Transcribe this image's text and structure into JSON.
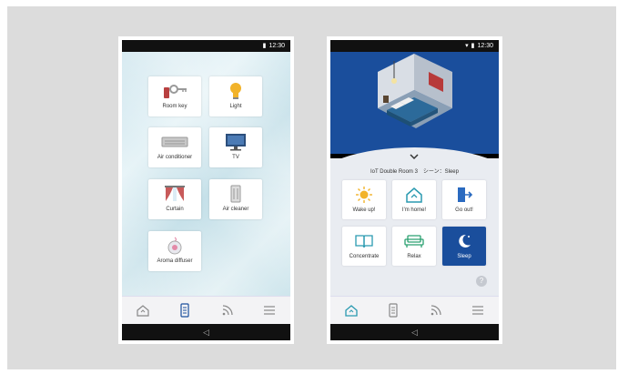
{
  "colors": {
    "accent": "#1a4e9c",
    "background": "#dcdcdc"
  },
  "status_bar": {
    "time": "12:30"
  },
  "nav_bar": {
    "back_glyph": "◁"
  },
  "devices_screen": {
    "tiles": [
      {
        "label": "Room key",
        "icon": "room-key-icon"
      },
      {
        "label": "Light",
        "icon": "light-bulb-icon"
      },
      {
        "label": "Air conditioner",
        "icon": "air-conditioner-icon"
      },
      {
        "label": "TV",
        "icon": "tv-icon"
      },
      {
        "label": "Curtain",
        "icon": "curtain-icon"
      },
      {
        "label": "Air cleaner",
        "icon": "air-cleaner-icon"
      },
      {
        "label": "Aroma diffuser",
        "icon": "aroma-diffuser-icon"
      }
    ],
    "tabs": [
      "home-icon",
      "remote-icon",
      "wifi-icon",
      "menu-icon"
    ],
    "active_tab": "remote-icon"
  },
  "scenes_screen": {
    "room_title": "IoT Double Room 3　シーン：Sleep",
    "tiles": [
      {
        "label": "Wake up!",
        "icon": "sun-icon"
      },
      {
        "label": "I'm home!",
        "icon": "house-icon"
      },
      {
        "label": "Go out!",
        "icon": "door-exit-icon"
      },
      {
        "label": "Concentrate",
        "icon": "book-icon"
      },
      {
        "label": "Relax",
        "icon": "sofa-icon"
      },
      {
        "label": "Sleep",
        "icon": "moon-icon",
        "active": true
      }
    ],
    "help_glyph": "?",
    "tabs": [
      "home-icon",
      "remote-icon",
      "wifi-icon",
      "menu-icon"
    ],
    "active_tab": "home-icon"
  }
}
